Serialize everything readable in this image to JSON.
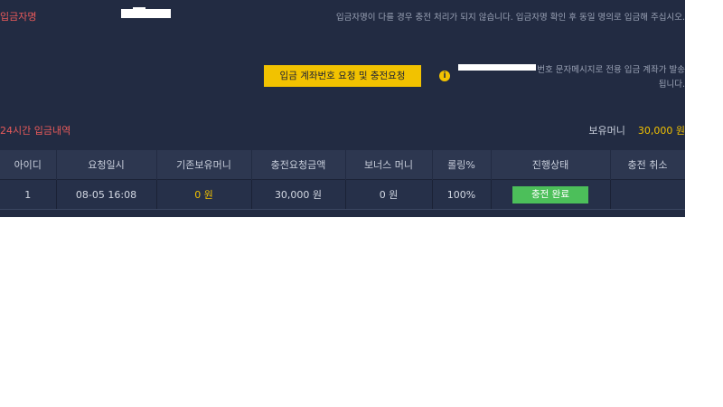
{
  "depositor": {
    "label": "입금자명"
  },
  "notice": "입금자명이 다를 경우 충전 처리가 되지 않습니다. 입금자명 확인 후 동일 명의로 입금해 주십시오.",
  "request_button": {
    "label": "입금 계좌번호 요청 및 충전요청"
  },
  "info": {
    "icon": "info-icon",
    "line1": "번호 문자메시지로 전용 입금 계좌가 발송",
    "line2": "됩니다."
  },
  "history": {
    "title": "24시간 입금내역"
  },
  "balance": {
    "label": "보유머니",
    "value": "30,000 원"
  },
  "table": {
    "columns": [
      "아이디",
      "요청일시",
      "기존보유머니",
      "충전요청금액",
      "보너스 머니",
      "롤링%",
      "진행상태",
      "충전 취소"
    ],
    "rows": [
      {
        "id": "1",
        "requested_at": "08-05 16:08",
        "prev_balance": "0 원",
        "amount": "30,000 원",
        "bonus": "0 원",
        "rolling": "100%",
        "status": "충전 완료",
        "cancel": ""
      }
    ]
  },
  "colors": {
    "panel_bg": "#222b42",
    "accent_yellow": "#f2c200",
    "label_red": "#e85a5a",
    "status_green": "#4cbf5a"
  }
}
